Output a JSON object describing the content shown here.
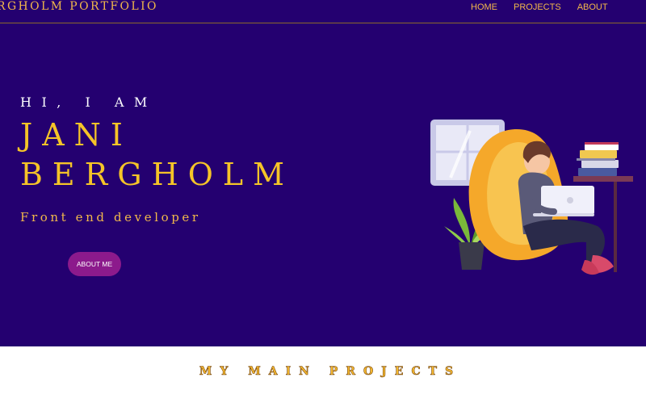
{
  "nav": {
    "brand": "RGHOLM PORTFOLIO",
    "links": [
      {
        "label": "HOME"
      },
      {
        "label": "PROJECTS"
      },
      {
        "label": "ABOUT"
      }
    ]
  },
  "hero": {
    "greeting": "HI, I AM",
    "first_name": "JANI",
    "last_name": "BERGHOLM",
    "role": "Front end developer",
    "about_button": "ABOUT ME",
    "illustration": "person-on-beanbag-with-laptop"
  },
  "projects": {
    "title": "MY MAIN PROJECTS"
  },
  "colors": {
    "hero_bg": "#240070",
    "accent_gold": "#f5c428",
    "button_bg": "#8c1a8c"
  }
}
